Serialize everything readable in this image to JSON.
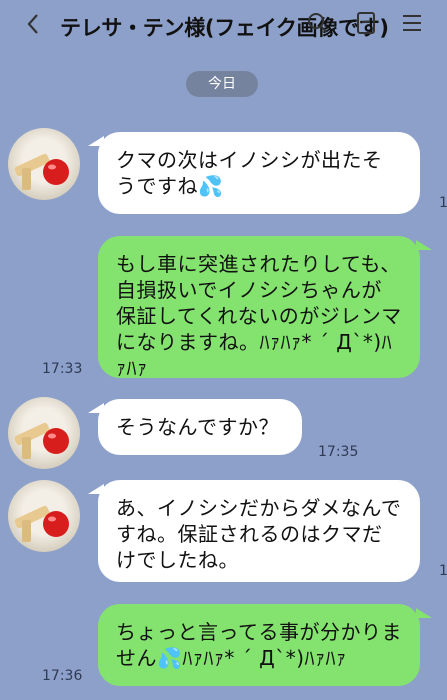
{
  "header": {
    "title": "テレサ・テン様(フェイク画像です)",
    "back_icon": "chevron-left-icon",
    "search_icon": "search-icon",
    "call_icon": "call-icon",
    "menu_icon": "menu-icon"
  },
  "date_label": "今日",
  "messages": [
    {
      "side": "left",
      "text": "クマの次はイノシシが出たそうですね💦"
    },
    {
      "side": "right",
      "text": "もし車に突進されたりしても、自損扱いでイノシシちゃんが保証してくれないのがジレンマになりますね。ﾊｧﾊｧ* ´ Д`*)ﾊｧﾊｧ",
      "time": "17:33"
    },
    {
      "side": "left",
      "text": "そうなんですか？",
      "time": "17:35"
    },
    {
      "side": "left",
      "text": "あ、イノシシだからダメなんですね。保証されるのはクマだけでしたね。"
    },
    {
      "side": "right",
      "text": "ちょっと言ってる事が分かりません💦ﾊｧﾊｧ* ´ Д`*)ﾊｧﾊｧ",
      "time": "17:36"
    }
  ],
  "colors": {
    "background": "#8da0c9",
    "incoming_bubble": "#ffffff",
    "outgoing_bubble": "#84e36f",
    "date_pill": "#75839f"
  }
}
